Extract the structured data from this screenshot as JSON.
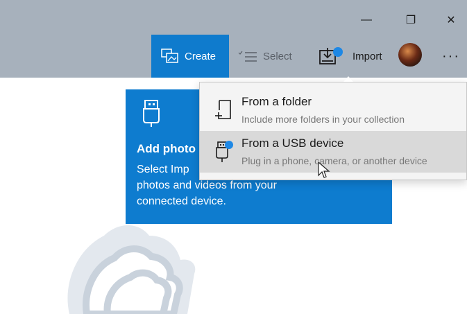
{
  "window": {
    "minimize_glyph": "—",
    "maximize_glyph": "❐",
    "close_glyph": "✕"
  },
  "toolbar": {
    "create_label": "Create",
    "select_label": "Select",
    "import_label": "Import",
    "more_glyph": "···"
  },
  "card": {
    "title": "Add photo",
    "lines": [
      "Select Imp",
      "photos and videos from your",
      "connected device."
    ]
  },
  "import_menu": {
    "items": [
      {
        "title": "From a folder",
        "description": "Include more folders in your collection"
      },
      {
        "title": "From a USB device",
        "description": "Plug in a phone, camera, or another device"
      }
    ]
  },
  "colors": {
    "accent": "#0f7bcd",
    "toolbar_bg": "#a7b1bc",
    "badge": "#1e88e5"
  }
}
